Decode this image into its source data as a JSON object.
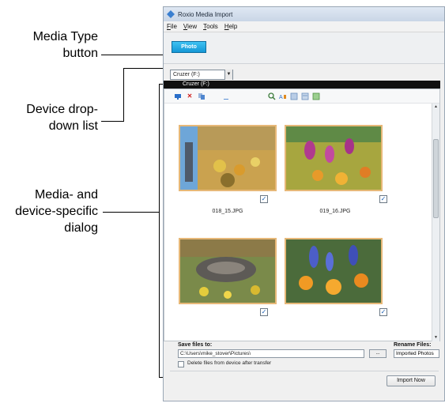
{
  "callouts": {
    "media_type_line1": "Media Type",
    "media_type_line2": "button",
    "device_line1": "Device drop-",
    "device_line2": "down list",
    "dialog_line1": "Media- and",
    "dialog_line2": "device-specific",
    "dialog_line3": "dialog"
  },
  "window": {
    "title": "Roxio Media Import",
    "menu": [
      "File",
      "View",
      "Tools",
      "Help"
    ]
  },
  "media_type": {
    "label": "Photo"
  },
  "device": {
    "selected": "Cruzer (F:)",
    "header": "Cruzer (F:)"
  },
  "toolbar_icons": [
    "monitor-icon",
    "delete-icon",
    "copy-icon",
    "upload-icon",
    "zoom-icon",
    "sort-icon",
    "view-list-icon",
    "view-details-icon",
    "view-thumbs-icon"
  ],
  "thumbnails": [
    {
      "filename": "018_15.JPG",
      "checked": true
    },
    {
      "filename": "019_16.JPG",
      "checked": true
    },
    {
      "filename": "",
      "checked": true
    },
    {
      "filename": "",
      "checked": true
    }
  ],
  "save": {
    "label": "Save files to:",
    "path": "C:\\Users\\mike_stover\\Pictures\\",
    "browse": "...",
    "delete_label": "Delete files from device after transfer"
  },
  "rename": {
    "label": "Rename Files:",
    "value": "Imported Photos"
  },
  "import_button": "Import Now",
  "colors": {
    "photo_button": "#1497d6",
    "thumb_border": "#e7b878",
    "header": "#101010"
  }
}
